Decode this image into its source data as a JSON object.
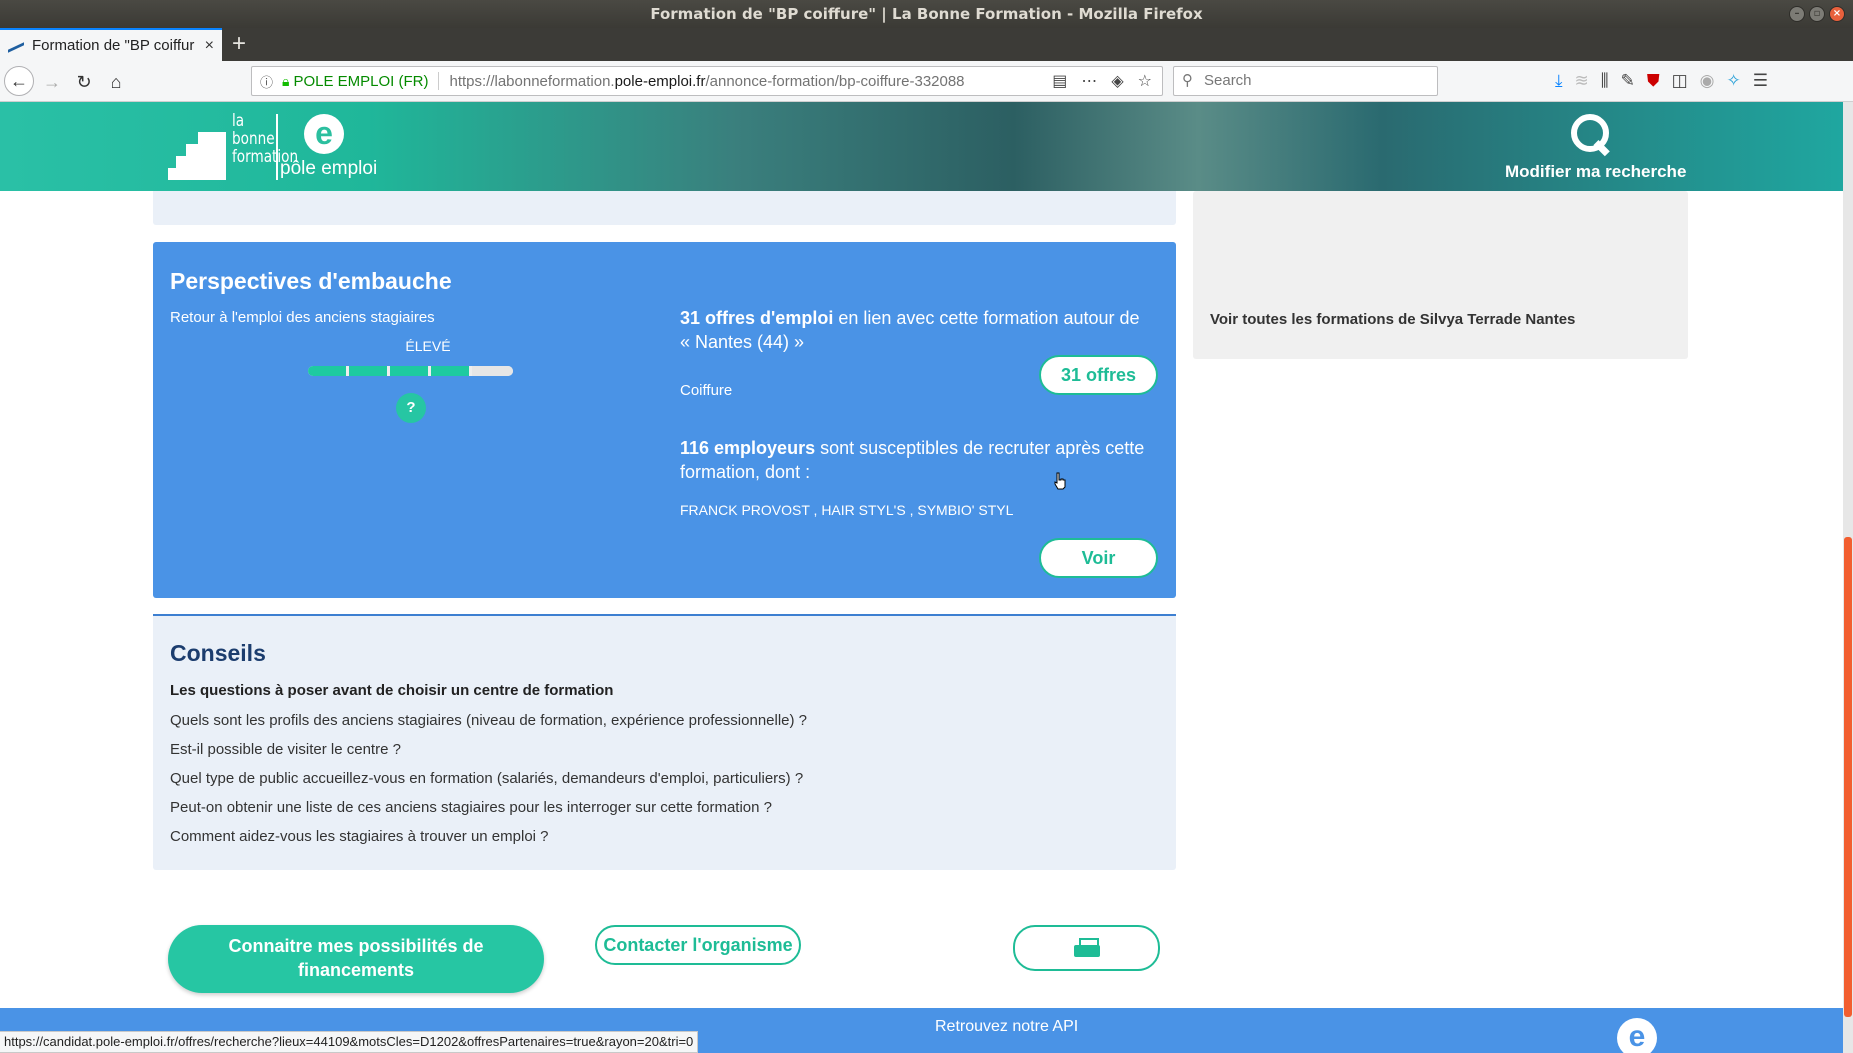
{
  "window": {
    "title": "Formation de \"BP coiffure\" | La Bonne Formation - Mozilla Firefox"
  },
  "tab": {
    "title": "Formation de \"BP coiffur",
    "close": "×",
    "new": "+"
  },
  "urlbar": {
    "org": "POLE EMPLOI (FR)",
    "prefix": "https://labonneformation.",
    "domain": "pole-emploi.fr",
    "path": "/annonce-formation/bp-coiffure-332088"
  },
  "searchbar": {
    "placeholder": "Search"
  },
  "header": {
    "logo_words": [
      "la",
      "bonne",
      "formation"
    ],
    "pe_letter": "e",
    "pe_text": "pôle emploi",
    "modify_search": "Modifier ma recherche"
  },
  "sidebar": {
    "link": "Voir toutes les formations de Silvya Terrade Nantes"
  },
  "perspectives": {
    "title": "Perspectives d'embauche",
    "retour_label": "Retour à l'emploi des anciens stagiaires",
    "level": "ÉLEVÉ",
    "gauge_fraction": 0.8,
    "help": "?",
    "offres_count": "31 offres d'emploi",
    "offres_text": " en lien avec cette formation autour de « Nantes (44) »",
    "metier": "Coiffure",
    "offres_button": "31 offres",
    "employeurs_count": "116 employeurs",
    "employeurs_text": " sont susceptibles de recruter après cette formation, dont :",
    "employeurs_list": "FRANCK PROVOST , HAIR STYL'S , SYMBIO' STYL",
    "voir_button": "Voir"
  },
  "conseils": {
    "title": "Conseils",
    "subtitle": "Les questions à poser avant de choisir un centre de formation",
    "questions": [
      "Quels sont les profils des anciens stagiaires (niveau de formation, expérience professionnelle) ?",
      "Est-il possible de visiter le centre ?",
      "Quel type de public accueillez-vous en formation (salariés, demandeurs d'emploi, particuliers) ?",
      "Peut-on obtenir une liste de ces anciens stagiaires pour les interroger sur cette formation ?",
      "Comment aidez-vous les stagiaires à trouver un emploi ?"
    ]
  },
  "actions": {
    "financement": "Connaitre mes possibilités de financements",
    "contact": "Contacter l'organisme",
    "print_icon": "printer-icon"
  },
  "footer": {
    "api": "Retrouvez notre API",
    "pe_letter": "e"
  },
  "statusbar": {
    "url": "https://candidat.pole-emploi.fr/offres/recherche?lieux=44109&motsCles=D1202&offresPartenaires=true&rayon=20&tri=0"
  },
  "colors": {
    "accent": "#26c6a3",
    "perspectives_bg": "#4a93e6",
    "conseils_bg": "#eaf0f8",
    "scroll_thumb": "#f25e2f"
  }
}
